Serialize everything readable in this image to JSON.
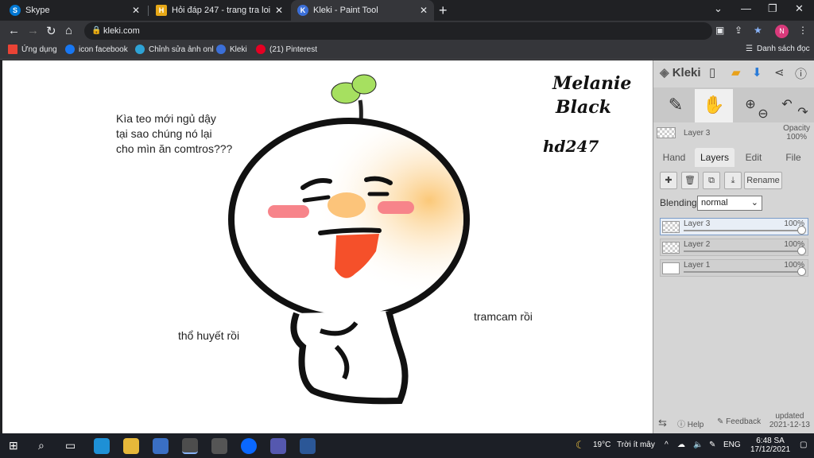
{
  "browser": {
    "tabs": [
      {
        "title": "Skype",
        "icon": "skype-icon",
        "color": "#0078d4"
      },
      {
        "title": "Hỏi đáp 247 - trang tra loi",
        "icon": "hoidap-icon",
        "color": "#e6a817"
      },
      {
        "title": "Kleki - Paint Tool",
        "icon": "kleki-icon",
        "color": "#3b6fd8"
      }
    ],
    "url": "kleki.com",
    "avatar_letter": "N",
    "bookmarks": [
      {
        "label": "Ứng dụng",
        "color": "#ea4335"
      },
      {
        "label": "icon facebook",
        "color": "#1877f2"
      },
      {
        "label": "Chỉnh sửa ảnh onl",
        "color": "#2ea3d6"
      },
      {
        "label": "Kleki",
        "color": "#3b6fd8"
      },
      {
        "label": "(21) Pinterest",
        "color": "#e60023"
      }
    ],
    "reading_list": "Danh sách đọc"
  },
  "canvas": {
    "text1": [
      "Kìa teo mới ngủ dậy",
      "tại sao chúng nó lại",
      "cho mìn ăn comtros???"
    ],
    "text2": "thổ huyết rồi",
    "text3": "tramcam rồi",
    "handwriting": [
      "Melanie",
      "Black",
      "hd247"
    ]
  },
  "panel": {
    "logo": "Kleki",
    "layer_name": "Layer 3",
    "opacity_label": "Opacity",
    "opacity_value": "100%",
    "tabs": [
      "Hand",
      "Layers",
      "Edit",
      "File"
    ],
    "active_tab": "Layers",
    "rename": "Rename",
    "blending_label": "Blending",
    "blending_value": "normal",
    "layers": [
      {
        "name": "Layer 3",
        "opacity": "100%",
        "active": true
      },
      {
        "name": "Layer 2",
        "opacity": "100%",
        "active": false
      },
      {
        "name": "Layer 1",
        "opacity": "100%",
        "active": false
      }
    ],
    "help": "Help",
    "feedback": "Feedback",
    "updated_label": "updated",
    "updated_date": "2021-12-13"
  },
  "taskbar": {
    "weather": "19°C",
    "weather_desc": "Trời ít mây",
    "lang": "ENG",
    "time": "6:48 SA",
    "date": "17/12/2021"
  }
}
